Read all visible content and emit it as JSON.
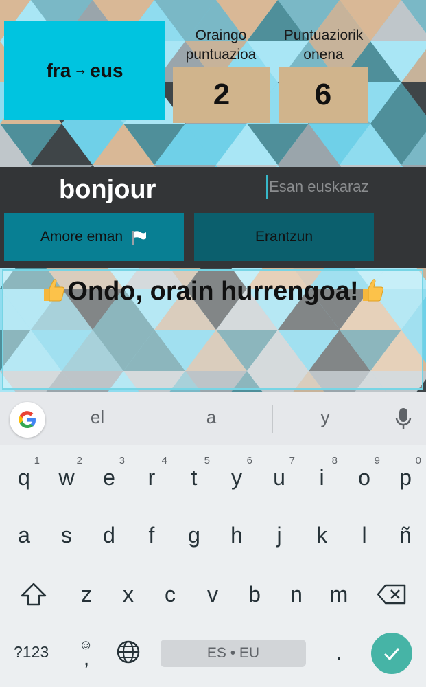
{
  "header": {
    "direction": {
      "from": "fra",
      "arrow": "→",
      "to": "eus"
    },
    "current_score_label": "Oraingo puntuazioa",
    "current_score": "2",
    "best_score_label": "Puntuaziorik onena",
    "best_score": "6"
  },
  "quiz": {
    "word": "bonjour",
    "answer_placeholder": "Esan euskaraz",
    "give_up_label": "Amore eman",
    "answer_label": "Erantzun",
    "feedback": "Ondo, orain hurrengoa!"
  },
  "keyboard": {
    "suggestions": [
      "el",
      "a",
      "y"
    ],
    "row1": [
      {
        "key": "q",
        "hint": "1"
      },
      {
        "key": "w",
        "hint": "2"
      },
      {
        "key": "e",
        "hint": "3"
      },
      {
        "key": "r",
        "hint": "4"
      },
      {
        "key": "t",
        "hint": "5"
      },
      {
        "key": "y",
        "hint": "6"
      },
      {
        "key": "u",
        "hint": "7"
      },
      {
        "key": "i",
        "hint": "8"
      },
      {
        "key": "o",
        "hint": "9"
      },
      {
        "key": "p",
        "hint": "0"
      }
    ],
    "row2": [
      "a",
      "s",
      "d",
      "f",
      "g",
      "h",
      "j",
      "k",
      "l",
      "ñ"
    ],
    "row3": [
      "z",
      "x",
      "c",
      "v",
      "b",
      "n",
      "m"
    ],
    "symbols_label": "?123",
    "comma": ",",
    "period": ".",
    "space_label": "ES • EU",
    "icons": [
      "google-icon",
      "mic-icon",
      "shift-icon",
      "backspace-icon",
      "emoji-icon",
      "globe-icon",
      "checkmark-icon"
    ]
  },
  "colors": {
    "lang_box": "#00c4e0",
    "score_box": "#d0b48c",
    "dark_band": "#333537",
    "give_up_button": "#087f93",
    "answer_button": "#0b5f6d",
    "enter_key": "#46b4a6"
  }
}
